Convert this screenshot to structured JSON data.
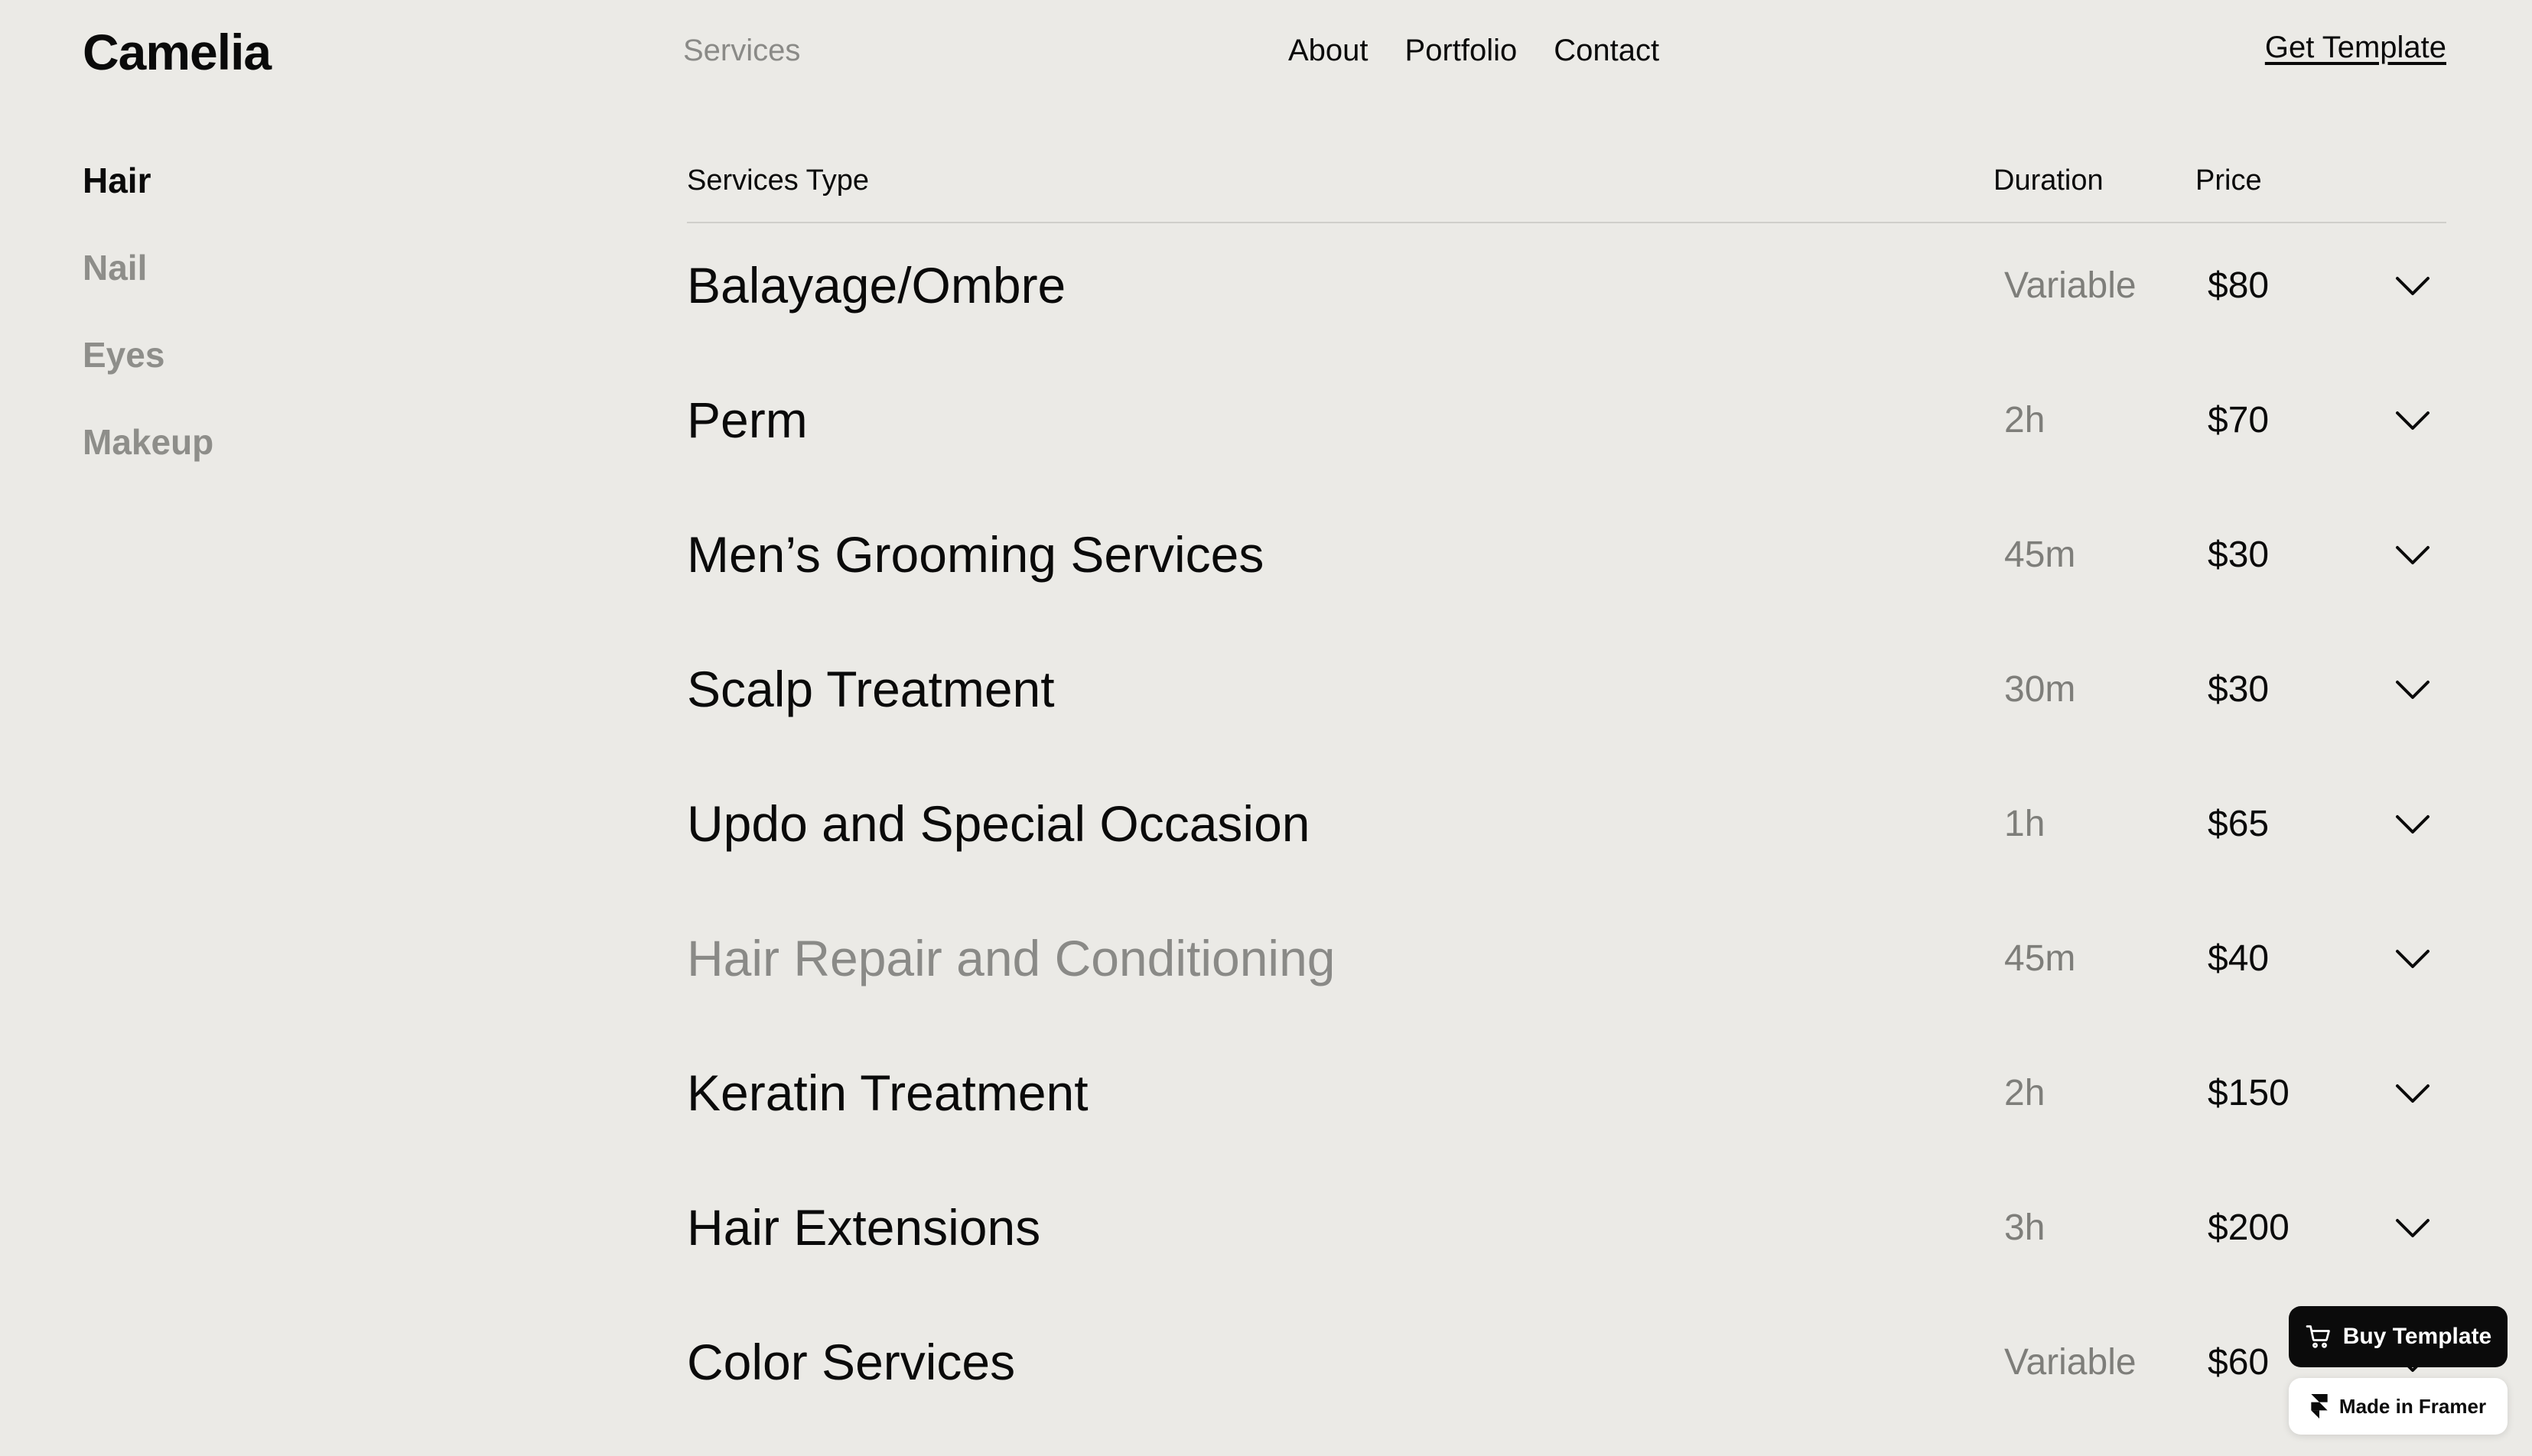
{
  "header": {
    "logo": "Camelia",
    "services_link": "Services",
    "nav": [
      "About",
      "Portfolio",
      "Contact"
    ],
    "cta": "Get Template"
  },
  "sidebar": {
    "items": [
      {
        "label": "Hair",
        "active": true
      },
      {
        "label": "Nail",
        "active": false
      },
      {
        "label": "Eyes",
        "active": false
      },
      {
        "label": "Makeup",
        "active": false
      }
    ]
  },
  "table": {
    "headers": {
      "type": "Services Type",
      "duration": "Duration",
      "price": "Price"
    },
    "rows": [
      {
        "name": "Balayage/Ombre",
        "duration": "Variable",
        "price": "$80",
        "muted": false
      },
      {
        "name": "Perm",
        "duration": "2h",
        "price": "$70",
        "muted": false
      },
      {
        "name": "Men’s Grooming Services",
        "duration": "45m",
        "price": "$30",
        "muted": false
      },
      {
        "name": "Scalp Treatment",
        "duration": "30m",
        "price": "$30",
        "muted": false
      },
      {
        "name": "Updo and Special Occasion",
        "duration": "1h",
        "price": "$65",
        "muted": false
      },
      {
        "name": "Hair Repair and Conditioning",
        "duration": "45m",
        "price": "$40",
        "muted": true
      },
      {
        "name": "Keratin Treatment",
        "duration": "2h",
        "price": "$150",
        "muted": false
      },
      {
        "name": "Hair Extensions",
        "duration": "3h",
        "price": "$200",
        "muted": false
      },
      {
        "name": "Color Services",
        "duration": "Variable",
        "price": "$60",
        "muted": false
      }
    ]
  },
  "badges": {
    "buy": "Buy Template",
    "framer": "Made in Framer"
  },
  "icons": {
    "row_expand": "chevron-down-icon",
    "buy": "cart-icon",
    "framer": "framer-logo-icon"
  },
  "colors": {
    "background": "#EBEAE6",
    "text": "#0A0A0A",
    "muted": "#8A8A87"
  }
}
